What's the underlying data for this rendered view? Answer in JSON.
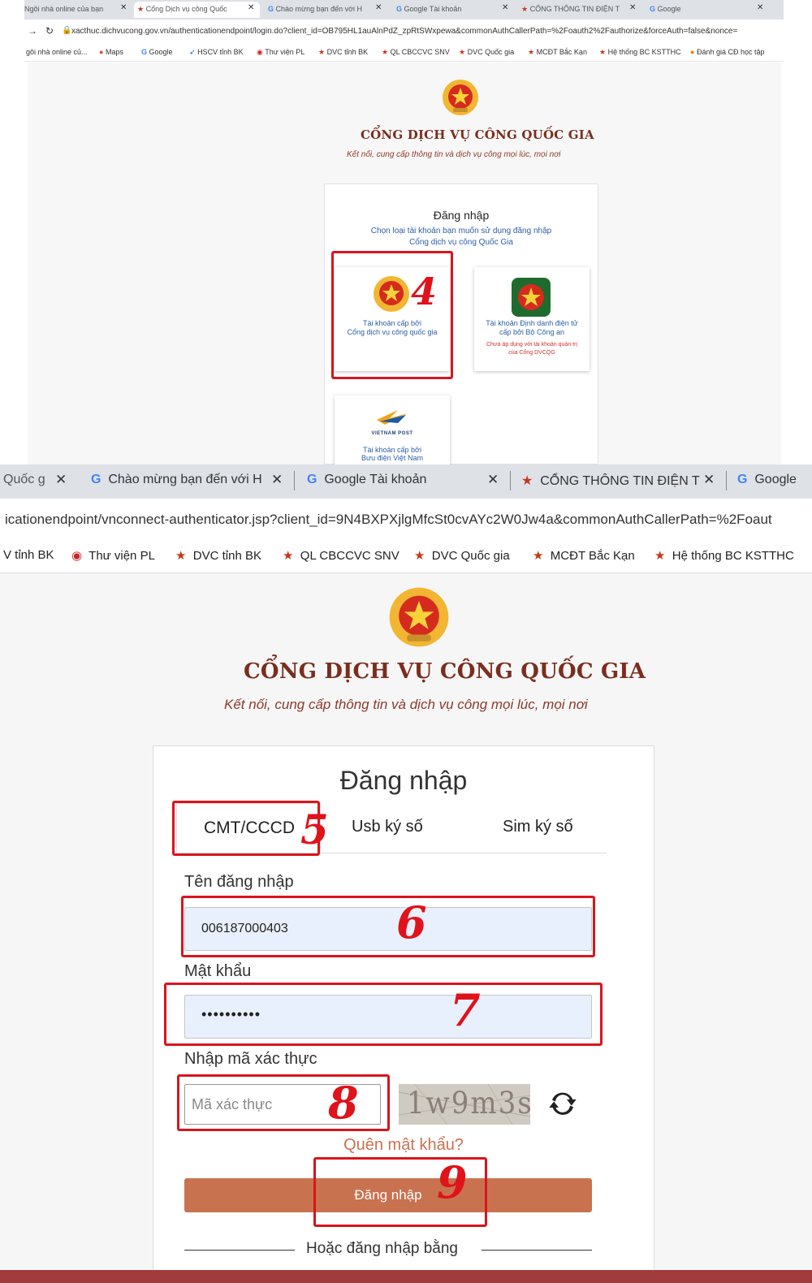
{
  "top": {
    "tabs": [
      {
        "label": "Ngôi nhà online của bạn"
      },
      {
        "label": "Cổng Dịch vụ công Quốc"
      },
      {
        "label": "Chào mừng bạn đến với H"
      },
      {
        "label": "Google Tài khoản"
      },
      {
        "label": "CỔNG THÔNG TIN ĐIỆN T"
      },
      {
        "label": "Google"
      }
    ],
    "url": "xacthuc.dichvucong.gov.vn/authenticationendpoint/login.do?client_id=OB795HL1auAlnPdZ_zpRtSWxpewa&commonAuthCallerPath=%2Foauth2%2Fauthorize&forceAuth=false&nonce=",
    "bookmarks": [
      "gôi nhà online củ...",
      "Maps",
      "Google",
      "HSCV tỉnh BK",
      "Thư viện PL",
      "DVC tỉnh BK",
      "QL CBCCVC SNV",
      "DVC Quốc gia",
      "MCĐT Bắc Kạn",
      "Hệ thống BC KSTTHC",
      "Đánh giá CĐ học tập"
    ],
    "brand_title": "CỔNG DỊCH VỤ CÔNG QUỐC GIA",
    "brand_subtitle": "Kết nối, cung cấp thông tin và dịch vụ công mọi lúc, mọi nơi",
    "login_heading": "Đăng nhập",
    "login_hint_1": "Chọn loại tài khoản bạn muốn sử dụng đăng nhập",
    "login_hint_2": "Cổng dịch vụ công Quốc Gia",
    "option1_line1": "Tài khoản cấp bởi",
    "option1_line2": "Cổng dịch vụ công quốc gia",
    "option2_line1": "Tài khoản Định danh điện tử",
    "option2_line2": "cấp bởi Bộ Công an",
    "option2_warn1": "Chưa áp dụng với tài khoản quản trị",
    "option2_warn2": "của Cổng DVCQG",
    "option3_brand": "VIETNAM POST",
    "option3_line1": "Tài khoản cấp bởi",
    "option3_line2": "Bưu điện Việt Nam",
    "annotation": "4"
  },
  "bottom": {
    "tabs": [
      {
        "label": "Quốc g"
      },
      {
        "label": "Chào mừng bạn đến với H"
      },
      {
        "label": "Google Tài khoản"
      },
      {
        "label": "CỔNG THÔNG TIN ĐIỆN T"
      },
      {
        "label": "Google"
      }
    ],
    "url": "icationendpoint/vnconnect-authenticator.jsp?client_id=9N4BXPXjlgMfcSt0cvAYc2W0Jw4a&commonAuthCallerPath=%2Foaut",
    "bookmarks": [
      "V tỉnh BK",
      "Thư viện PL",
      "DVC tỉnh BK",
      "QL CBCCVC SNV",
      "DVC Quốc gia",
      "MCĐT Bắc Kạn",
      "Hệ thống BC KSTTHC"
    ],
    "brand_title": "CỔNG DỊCH VỤ CÔNG QUỐC GIA",
    "brand_subtitle": "Kết nối, cung cấp thông tin và dịch vụ công mọi lúc, mọi nơi",
    "login_heading": "Đăng nhập",
    "tab_cmt": "CMT/CCCD",
    "tab_usb": "Usb ký số",
    "tab_sim": "Sim ký số",
    "username_label": "Tên đăng nhập",
    "username_value": "006187000403",
    "password_label": "Mật khẩu",
    "password_value": "••••••••••",
    "captcha_label": "Nhập mã xác thực",
    "captcha_placeholder": "Mã xác thực",
    "captcha_text": "1w9m3s",
    "forgot_password": "Quên mật khẩu?",
    "login_button": "Đăng nhập",
    "or_login_with": "Hoặc đăng nhập bằng",
    "annotations": [
      "5",
      "6",
      "7",
      "8",
      "9"
    ]
  },
  "colors": {
    "brand_red": "#7a2e1e",
    "accent_blue": "#2b5ea8",
    "button": "#c97250",
    "annotation_red": "#d9151c",
    "field_bg": "#e8f0fe"
  }
}
